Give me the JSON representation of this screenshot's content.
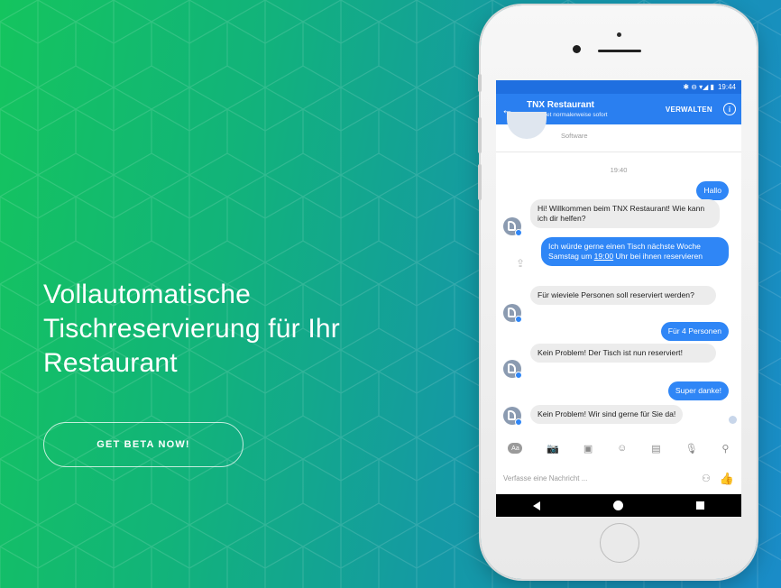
{
  "hero": {
    "headline_lines": [
      "Vollautomatische",
      "Tischreservierung für Ihr",
      "Restaurant"
    ],
    "cta_label": "GET BETA NOW!"
  },
  "phone": {
    "status_bar": {
      "time": "19:44",
      "icons": "✱ ⊖ ▾◢ ▮"
    },
    "app_bar": {
      "back": "←",
      "title": "TNX Restaurant",
      "subtitle": "Antwortet normalerweise sofort",
      "manage": "VERWALTEN",
      "info": "i"
    },
    "profile": {
      "type": "Software"
    },
    "timestamp": "19:40",
    "messages": {
      "m1": "Hallo",
      "m2": "Hi! Willkommen beim TNX Restaurant! Wie kann ich dir helfen?",
      "m3_a": "Ich würde gerne einen Tisch nächste Woche Samstag um ",
      "m3_time": "19:00",
      "m3_b": " Uhr bei ihnen reservieren",
      "m4": "Für wieviele Personen soll reserviert werden?",
      "m5": "Für 4 Personen",
      "m6": "Kein Problem! Der Tisch ist nun reserviert!",
      "m7": "Super danke!",
      "m8": "Kein Problem! Wir sind gerne für Sie da!"
    },
    "toolbar": {
      "aa": "Aa",
      "camera": "📷",
      "gallery": "▣",
      "emoji": "☺",
      "gif": "▤",
      "mic": "🎙",
      "location": "⚲"
    },
    "compose": {
      "placeholder": "Verfasse eine Nachricht ...",
      "sticker": "⚇",
      "like": "👍"
    },
    "icons": {
      "share": "⇪"
    }
  },
  "colors": {
    "brand_blue": "#2a7ff0",
    "bubble_blue": "#2f86f6",
    "gradient_green": "#14c45e",
    "gradient_blue": "#1a8cc8"
  }
}
